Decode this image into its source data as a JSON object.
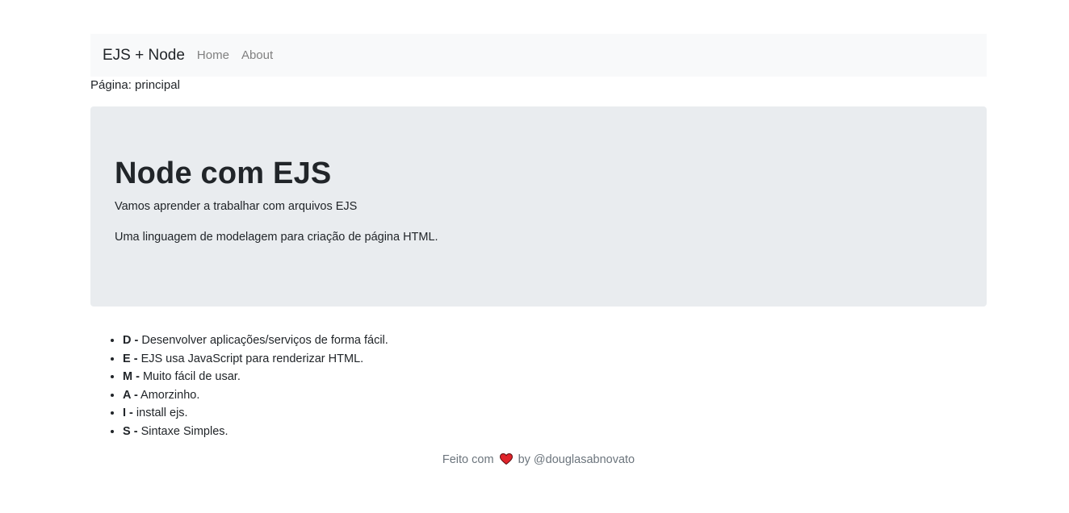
{
  "navbar": {
    "brand": "EJS + Node",
    "links": [
      {
        "label": "Home"
      },
      {
        "label": "About"
      }
    ]
  },
  "page_label": "Página: principal",
  "jumbotron": {
    "title": "Node com EJS",
    "subtitle": "Vamos aprender a trabalhar com arquivos EJS",
    "description": "Uma linguagem de modelagem para criação de página HTML."
  },
  "acronym_list": [
    {
      "letter": "D -",
      "text": "Desenvolver aplicações/serviços de forma fácil."
    },
    {
      "letter": "E -",
      "text": "EJS usa JavaScript para renderizar HTML."
    },
    {
      "letter": "M -",
      "text": "Muito fácil de usar."
    },
    {
      "letter": "A -",
      "text": "Amorzinho."
    },
    {
      "letter": "I -",
      "text": "install ejs."
    },
    {
      "letter": "S -",
      "text": "Sintaxe Simples."
    }
  ],
  "footer": {
    "prefix": "Feito com",
    "icon": "heart-icon",
    "suffix": "by @douglasabnovato",
    "heart_color": "#e0242b"
  }
}
